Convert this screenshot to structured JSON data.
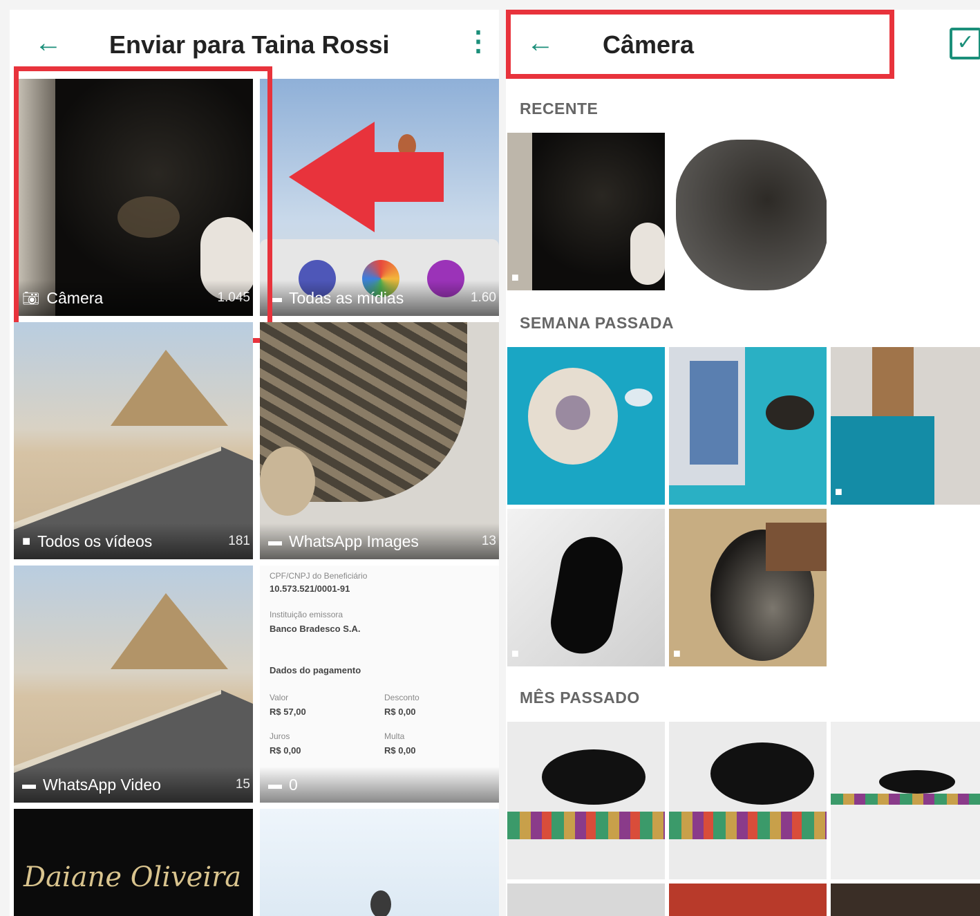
{
  "left_screen": {
    "title": "Enviar para Taina Rossi",
    "folders": [
      {
        "label": "Câmera",
        "count": "1.045"
      },
      {
        "label": "Todas as mídias",
        "count": "1.60"
      },
      {
        "label": "Todos os vídeos",
        "count": "181"
      },
      {
        "label": "WhatsApp Images",
        "count": "13"
      },
      {
        "label": "WhatsApp Video",
        "count": "15"
      },
      {
        "label": "0",
        "count": ""
      }
    ],
    "doc_preview": {
      "cpf_label": "CPF/CNPJ do Beneficiário",
      "cpf_value": "10.573.521/0001-91",
      "inst_label": "Instituição emissora",
      "inst_value": "Banco Bradesco S.A.",
      "section": "Dados do pagamento",
      "valor_label": "Valor",
      "valor": "R$ 57,00",
      "desconto_label": "Desconto",
      "desconto": "R$ 0,00",
      "juros_label": "Juros",
      "juros": "R$ 0,00",
      "multa_label": "Multa",
      "multa": "R$ 0,00"
    },
    "signature_text": "Daiane Oliveira"
  },
  "right_screen": {
    "title": "Câmera",
    "sections": [
      "RECENTE",
      "SEMANA PASSADA",
      "MÊS PASSADO"
    ]
  },
  "colors": {
    "accent": "#1b8f7a",
    "highlight": "#e8333c"
  },
  "icons": {
    "back": "arrow-left-icon",
    "menu": "more-vertical-icon",
    "select": "checkbox-icon",
    "camera": "camera-icon",
    "folder": "folder-icon",
    "video": "video-icon"
  }
}
